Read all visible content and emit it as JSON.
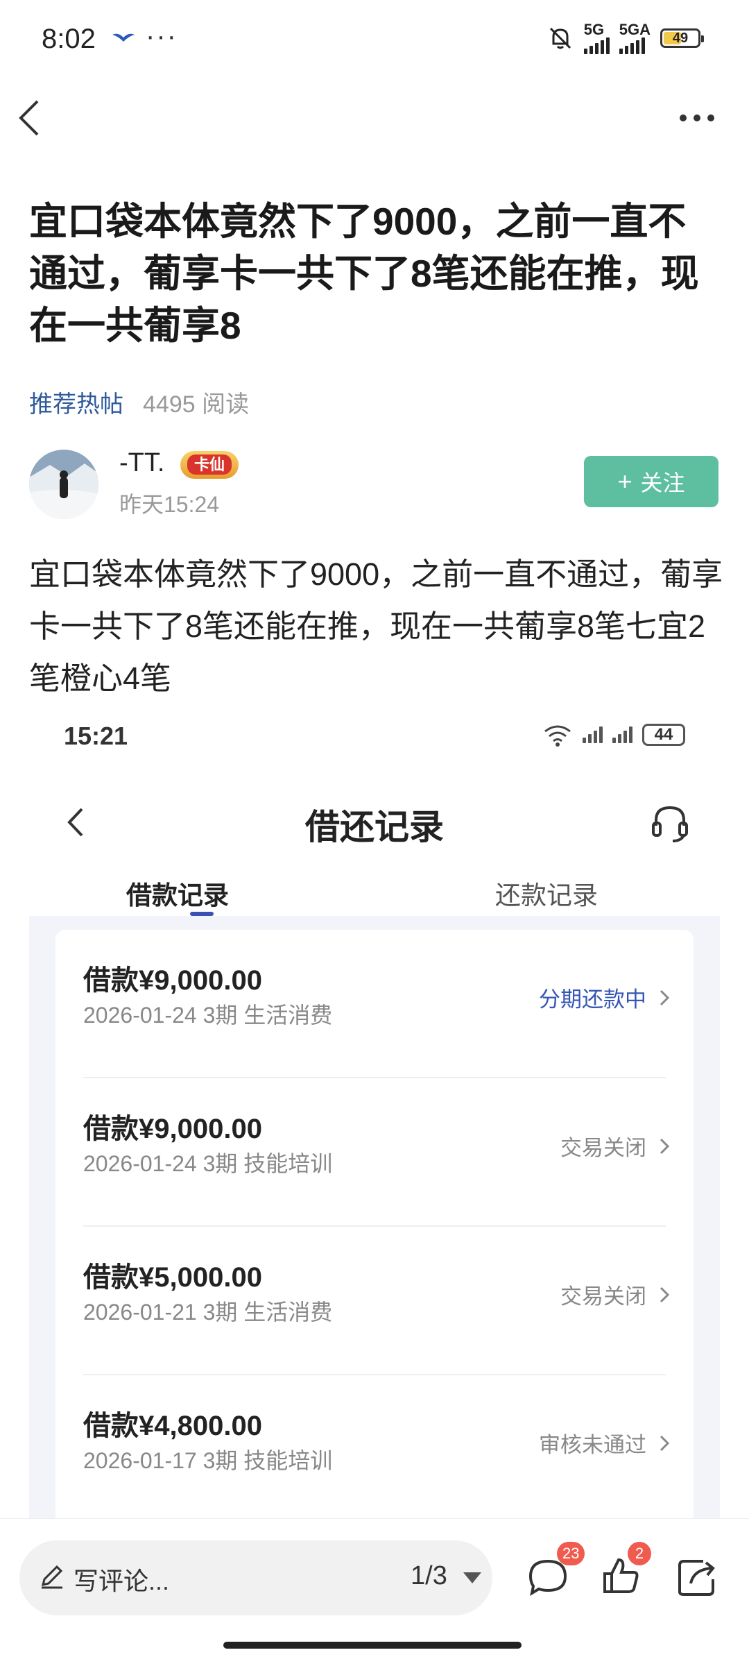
{
  "status_bar": {
    "time": "8:02",
    "dots": "···",
    "net1": "5G",
    "net2": "5GA",
    "battery": "49"
  },
  "post": {
    "title": "宜口袋本体竟然下了9000，之前一直不通过，葡享卡一共下了8笔还能在推，现在一共葡享8",
    "tag": "推荐热帖",
    "read_count": "4495 阅读",
    "author": {
      "name": "-TT.",
      "badge": "卡仙",
      "time": "昨天15:24"
    },
    "follow_label": "关注",
    "body": "宜口袋本体竟然下了9000，之前一直不通过，葡享卡一共下了8笔还能在推，现在一共葡享8笔七宜2笔橙心4笔"
  },
  "embedded": {
    "status_time": "15:21",
    "battery": "44",
    "title": "借还记录",
    "tabs": [
      {
        "label": "借款记录",
        "active": true
      },
      {
        "label": "还款记录",
        "active": false
      }
    ],
    "records": [
      {
        "amount": "借款¥9,000.00",
        "detail": "2026-01-24 3期  生活消费",
        "status": "分期还款中",
        "status_color": "#3656b5"
      },
      {
        "amount": "借款¥9,000.00",
        "detail": "2026-01-24 3期  技能培训",
        "status": "交易关闭",
        "status_color": "#888888"
      },
      {
        "amount": "借款¥5,000.00",
        "detail": "2026-01-21 3期  生活消费",
        "status": "交易关闭",
        "status_color": "#888888"
      },
      {
        "amount": "借款¥4,800.00",
        "detail": "2026-01-17 3期  技能培训",
        "status": "审核未通过",
        "status_color": "#888888"
      }
    ]
  },
  "bottom_bar": {
    "comment_placeholder": "写评论...",
    "page_indicator": "1/3",
    "comment_count": "23",
    "like_count": "2"
  }
}
